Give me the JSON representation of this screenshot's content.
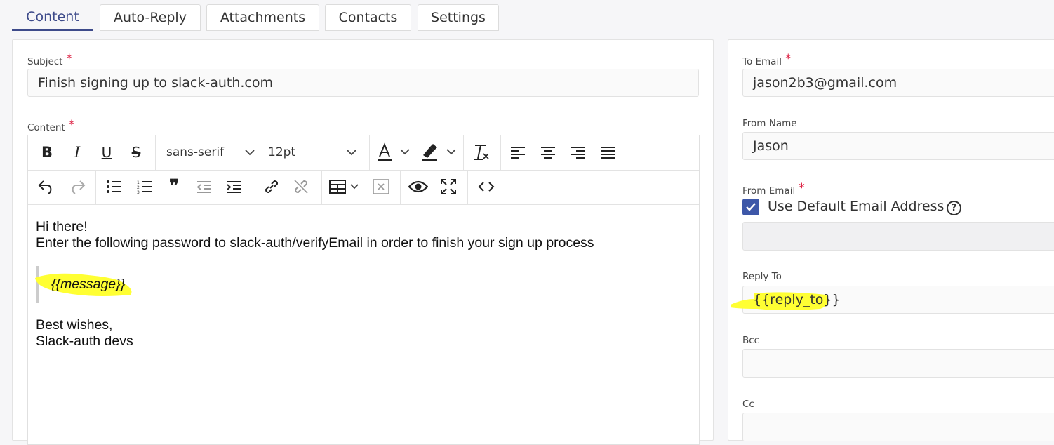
{
  "tabs": [
    {
      "label": "Content",
      "active": true
    },
    {
      "label": "Auto-Reply",
      "active": false
    },
    {
      "label": "Attachments",
      "active": false
    },
    {
      "label": "Contacts",
      "active": false
    },
    {
      "label": "Settings",
      "active": false
    }
  ],
  "left": {
    "subject_label": "Subject",
    "subject_value": "Finish signing up to slack-auth.com",
    "content_label": "Content",
    "required_mark": "*",
    "toolbar": {
      "font_family": "sans-serif",
      "font_size": "12pt",
      "icons_row1": [
        "bold-icon",
        "italic-icon",
        "underline-icon",
        "strikethrough-icon",
        "font-color-icon",
        "highlight-color-icon",
        "clear-format-icon",
        "align-left-icon",
        "align-center-icon",
        "align-right-icon",
        "align-justify-icon"
      ],
      "icons_row2": [
        "undo-icon",
        "redo-icon",
        "bullet-list-icon",
        "numbered-list-icon",
        "blockquote-icon",
        "outdent-icon",
        "indent-icon",
        "link-icon",
        "unlink-icon",
        "table-icon",
        "clear-table-icon",
        "preview-icon",
        "fullscreen-icon",
        "code-view-icon"
      ]
    },
    "body": {
      "line1": "Hi there!",
      "line2": "Enter the following password to slack-auth/verifyEmail in order to finish your sign up process",
      "quote": "{{message}}",
      "line3": "Best wishes,",
      "line4": "Slack-auth devs"
    }
  },
  "right": {
    "to_email_label": "To Email",
    "to_email_value": "jason2b3@gmail.com",
    "from_name_label": "From Name",
    "from_name_value": "Jason",
    "from_email_label": "From Email",
    "use_default_label": "Use Default Email Address",
    "use_default_checked": true,
    "help_glyph": "?",
    "from_email_value": "",
    "reply_to_label": "Reply To",
    "reply_to_value": "{{reply_to}}",
    "bcc_label": "Bcc",
    "bcc_value": "",
    "cc_label": "Cc",
    "cc_value": ""
  },
  "colors": {
    "accent": "#3d4a8a",
    "checkbox": "#3d57a8",
    "required": "#dd2244",
    "highlight": "#ffff33"
  }
}
